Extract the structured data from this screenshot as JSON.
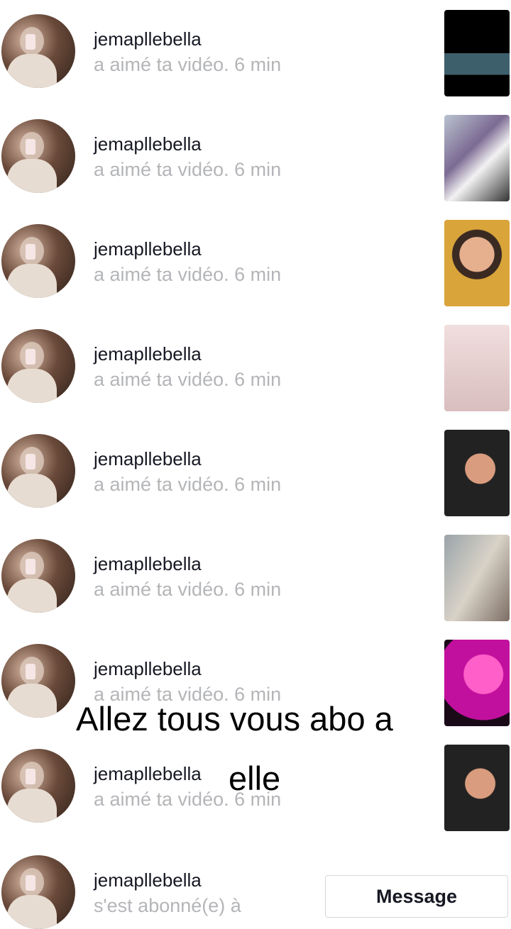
{
  "notifications": [
    {
      "username": "jemapllebella",
      "action": "a aimé ta vidéo.",
      "time": "6 min",
      "thumb": "video-thumbnail-1"
    },
    {
      "username": "jemapllebella",
      "action": "a aimé ta vidéo.",
      "time": "6 min",
      "thumb": "video-thumbnail-2"
    },
    {
      "username": "jemapllebella",
      "action": "a aimé ta vidéo.",
      "time": "6 min",
      "thumb": "video-thumbnail-3"
    },
    {
      "username": "jemapllebella",
      "action": "a aimé ta vidéo.",
      "time": "6 min",
      "thumb": "video-thumbnail-4"
    },
    {
      "username": "jemapllebella",
      "action": "a aimé ta vidéo.",
      "time": "6 min",
      "thumb": "video-thumbnail-5"
    },
    {
      "username": "jemapllebella",
      "action": "a aimé ta vidéo.",
      "time": "6 min",
      "thumb": "video-thumbnail-6"
    },
    {
      "username": "jemapllebella",
      "action": "a aimé ta vidéo.",
      "time": "6 min",
      "thumb": "video-thumbnail-7"
    },
    {
      "username": "jemapllebella",
      "action": "a aimé ta vidéo.",
      "time": "6 min",
      "thumb": "video-thumbnail-8"
    }
  ],
  "follow_notification": {
    "username": "jemapllebella",
    "action": "s'est abonné(e) à",
    "button_label": "Message"
  },
  "overlay_caption": {
    "line1": "Allez tous vous abo a",
    "line2": "elle"
  },
  "colors": {
    "username": "#161823",
    "secondary_text": "#b4b5b8",
    "button_border": "#d6d7d9"
  }
}
